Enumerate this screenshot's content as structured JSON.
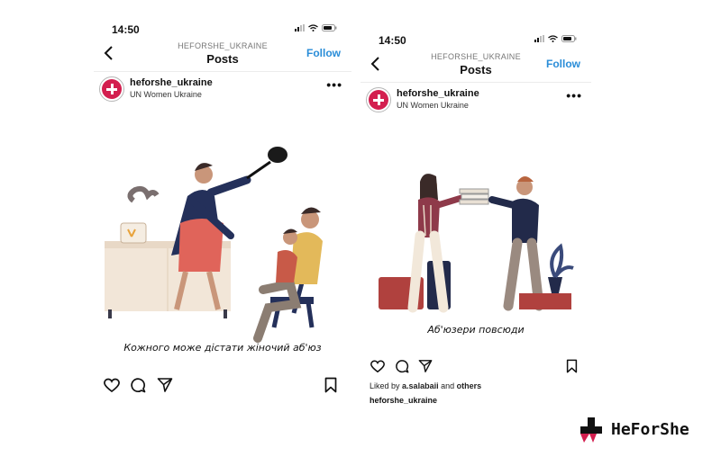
{
  "posts": [
    {
      "time": "14:50",
      "header_sub": "HEFORSHE_UKRAINE",
      "header_title": "Posts",
      "follow": "Follow",
      "username": "heforshe_ukraine",
      "org": "UN Women Ukraine",
      "more": "•••",
      "caption": "Кожного може дістати жіночий аб'юз"
    },
    {
      "time": "14:50",
      "header_sub": "HEFORSHE_UKRAINE",
      "header_title": "Posts",
      "follow": "Follow",
      "username": "heforshe_ukraine",
      "org": "UN Women Ukraine",
      "more": "•••",
      "caption": "Аб'юзери повсюди",
      "liked_prefix": "Liked by",
      "liked_user": "a.salabaii",
      "liked_and": "and",
      "liked_others": "others",
      "owner": "heforshe_ukraine"
    }
  ],
  "brand": {
    "name": "HeForShe",
    "color": "#d31f4f"
  },
  "icons": [
    "back-chevron-icon",
    "heart-icon",
    "comment-icon",
    "share-icon",
    "bookmark-icon",
    "signal-icon",
    "wifi-icon",
    "battery-icon"
  ]
}
